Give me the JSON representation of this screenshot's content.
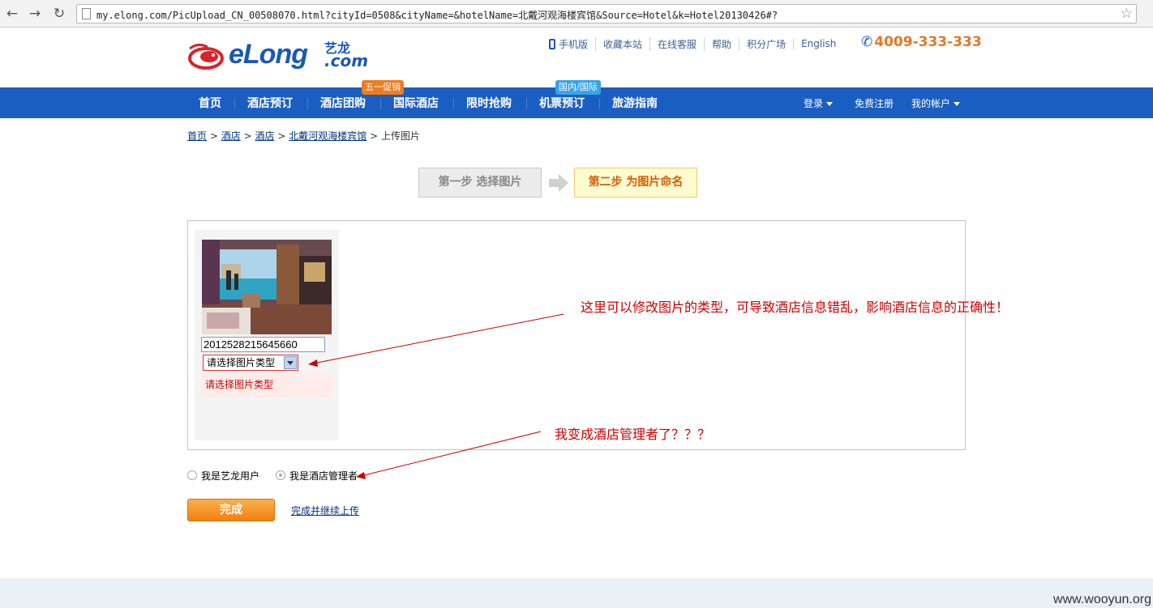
{
  "browser": {
    "url": "my.elong.com/PicUpload_CN_00508070.html?cityId=0508&cityName=&hotelName=北戴河观海楼宾馆&Source=Hotel&k=Hotel20130426#?"
  },
  "logo": {
    "text": "eLong",
    "cn": "艺龙",
    "com": ".com"
  },
  "top_links": [
    "手机版",
    "收藏本站",
    "在线客服",
    "帮助",
    "积分广场",
    "English"
  ],
  "hotline": "4009-333-333",
  "main_nav": {
    "items": [
      "首页",
      "酒店预订",
      "酒店团购",
      "国际酒店",
      "限时抢购",
      "机票预订",
      "旅游指南"
    ],
    "badge_promo": "五一促销",
    "badge_flight": "国内/国际",
    "login": "登录",
    "register": "免费注册",
    "account": "我的帐户"
  },
  "breadcrumb": {
    "items": [
      "首页",
      "酒店",
      "酒店",
      "北戴河观海楼宾馆"
    ],
    "current": "上传图片",
    "sep": ">"
  },
  "steps": {
    "step1": "第一步 选择图片",
    "step2": "第二步 为图片命名"
  },
  "upload": {
    "image_name": "201252821564566О",
    "type_select": "请选择图片类型",
    "error": "请选择图片类型"
  },
  "annotations": {
    "type_note": "这里可以修改图片的类型，可导致酒店信息错乱，影响酒店信息的正确性！",
    "manager_note": "我变成酒店管理者了？？？"
  },
  "roles": {
    "user": "我是艺龙用户",
    "manager": "我是酒店管理者",
    "selected": "manager"
  },
  "actions": {
    "finish": "完成",
    "continue": "完成并继续上传"
  },
  "watermark": "www.wooyun.org",
  "colors": {
    "brand_blue": "#1a5ec2",
    "hotline_orange": "#e57722",
    "annotation_red": "#cc0000"
  }
}
